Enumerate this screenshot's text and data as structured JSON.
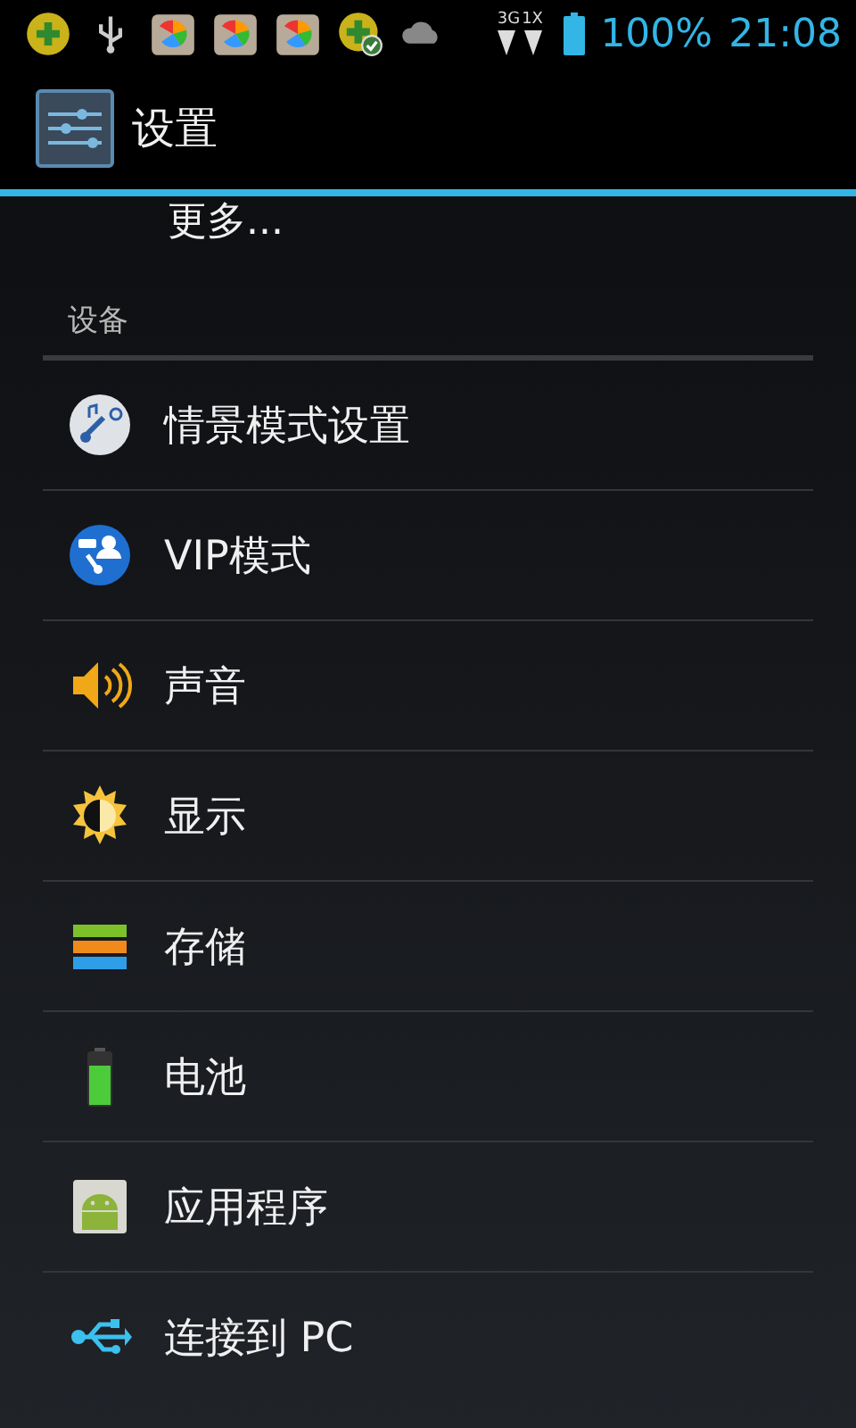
{
  "status_bar": {
    "notifications": [
      {
        "kind": "plus"
      },
      {
        "kind": "usb"
      },
      {
        "kind": "photo"
      },
      {
        "kind": "photo"
      },
      {
        "kind": "photo"
      },
      {
        "kind": "plus-check"
      },
      {
        "kind": "cloud"
      }
    ],
    "network_labels": [
      "3G",
      "1X"
    ],
    "battery_text": "100%",
    "time": "21:08"
  },
  "action_bar": {
    "title": "设置"
  },
  "partial_item": {
    "label": "更多..."
  },
  "section": {
    "title": "设备"
  },
  "items": [
    {
      "kind": "profile",
      "label": "情景模式设置"
    },
    {
      "kind": "vip",
      "label": "VIP模式"
    },
    {
      "kind": "sound",
      "label": "声音"
    },
    {
      "kind": "display",
      "label": "显示"
    },
    {
      "kind": "storage",
      "label": "存储"
    },
    {
      "kind": "battery",
      "label": "电池"
    },
    {
      "kind": "apps",
      "label": "应用程序"
    },
    {
      "kind": "usb",
      "label": "连接到 PC"
    }
  ]
}
